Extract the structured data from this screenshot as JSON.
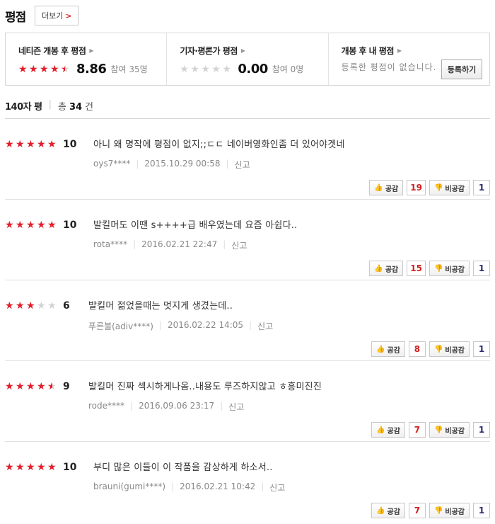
{
  "header": {
    "title": "평점",
    "more_label": "더보기",
    "more_arrow": ">"
  },
  "summary": {
    "netizen": {
      "title": "네티즌 개봉 후 평점",
      "score": "8.86",
      "score_fraction": 0.886,
      "participants": "참여 35명"
    },
    "critic": {
      "title": "기자·평론가 평점",
      "score": "0.00",
      "score_fraction": 0.0,
      "participants": "참여 0명"
    },
    "mine": {
      "title": "개봉 후 내 평점",
      "empty_text": "등록한 평점이 없습니다.",
      "register_label": "등록하기"
    }
  },
  "count_bar": {
    "label": "140자 평",
    "total_prefix": "총",
    "total": "34",
    "total_suffix": "건"
  },
  "vote_labels": {
    "up": "공감",
    "down": "비공감"
  },
  "reviews": [
    {
      "score": "10",
      "score_fraction": 1.0,
      "text": "아니 왜 명작에 평점이 없지;;ㄷㄷ 네이버영화인좀 더 있어야겟네",
      "user": "oys7****",
      "date": "2015.10.29 00:58",
      "report": "신고",
      "up": "19",
      "down": "1"
    },
    {
      "score": "10",
      "score_fraction": 1.0,
      "text": "발킬머도 이땐 s++++급 배우였는데 요즘 아쉽다..",
      "user": "rota****",
      "date": "2016.02.21 22:47",
      "report": "신고",
      "up": "15",
      "down": "1"
    },
    {
      "score": "6",
      "score_fraction": 0.6,
      "text": "발킬머 젊었을때는 멋지게 생겼는데..",
      "user": "푸른불(adiv****)",
      "date": "2016.02.22 14:05",
      "report": "신고",
      "up": "8",
      "down": "1"
    },
    {
      "score": "9",
      "score_fraction": 0.9,
      "text": "발킬머 진짜 섹시하게나옴..내용도 루즈하지않고 ㅎ흥미진진",
      "user": "rode****",
      "date": "2016.09.06 23:17",
      "report": "신고",
      "up": "7",
      "down": "1"
    },
    {
      "score": "10",
      "score_fraction": 1.0,
      "text": "부디 많은 이들이 이 작품을 감상하게 하소서..",
      "user": "brauni(gumi****)",
      "date": "2016.02.21 10:42",
      "report": "신고",
      "up": "7",
      "down": "1"
    }
  ],
  "icons": {
    "star": "star-icon",
    "thumb_up": "thumb-up-icon",
    "thumb_down": "thumb-down-icon",
    "triangle": "triangle-right-icon"
  },
  "colors": {
    "star_fill": "#e51d2a",
    "star_empty": "#d3d3d3",
    "up_count": "#d0201f",
    "down_count": "#2b2b6f"
  }
}
